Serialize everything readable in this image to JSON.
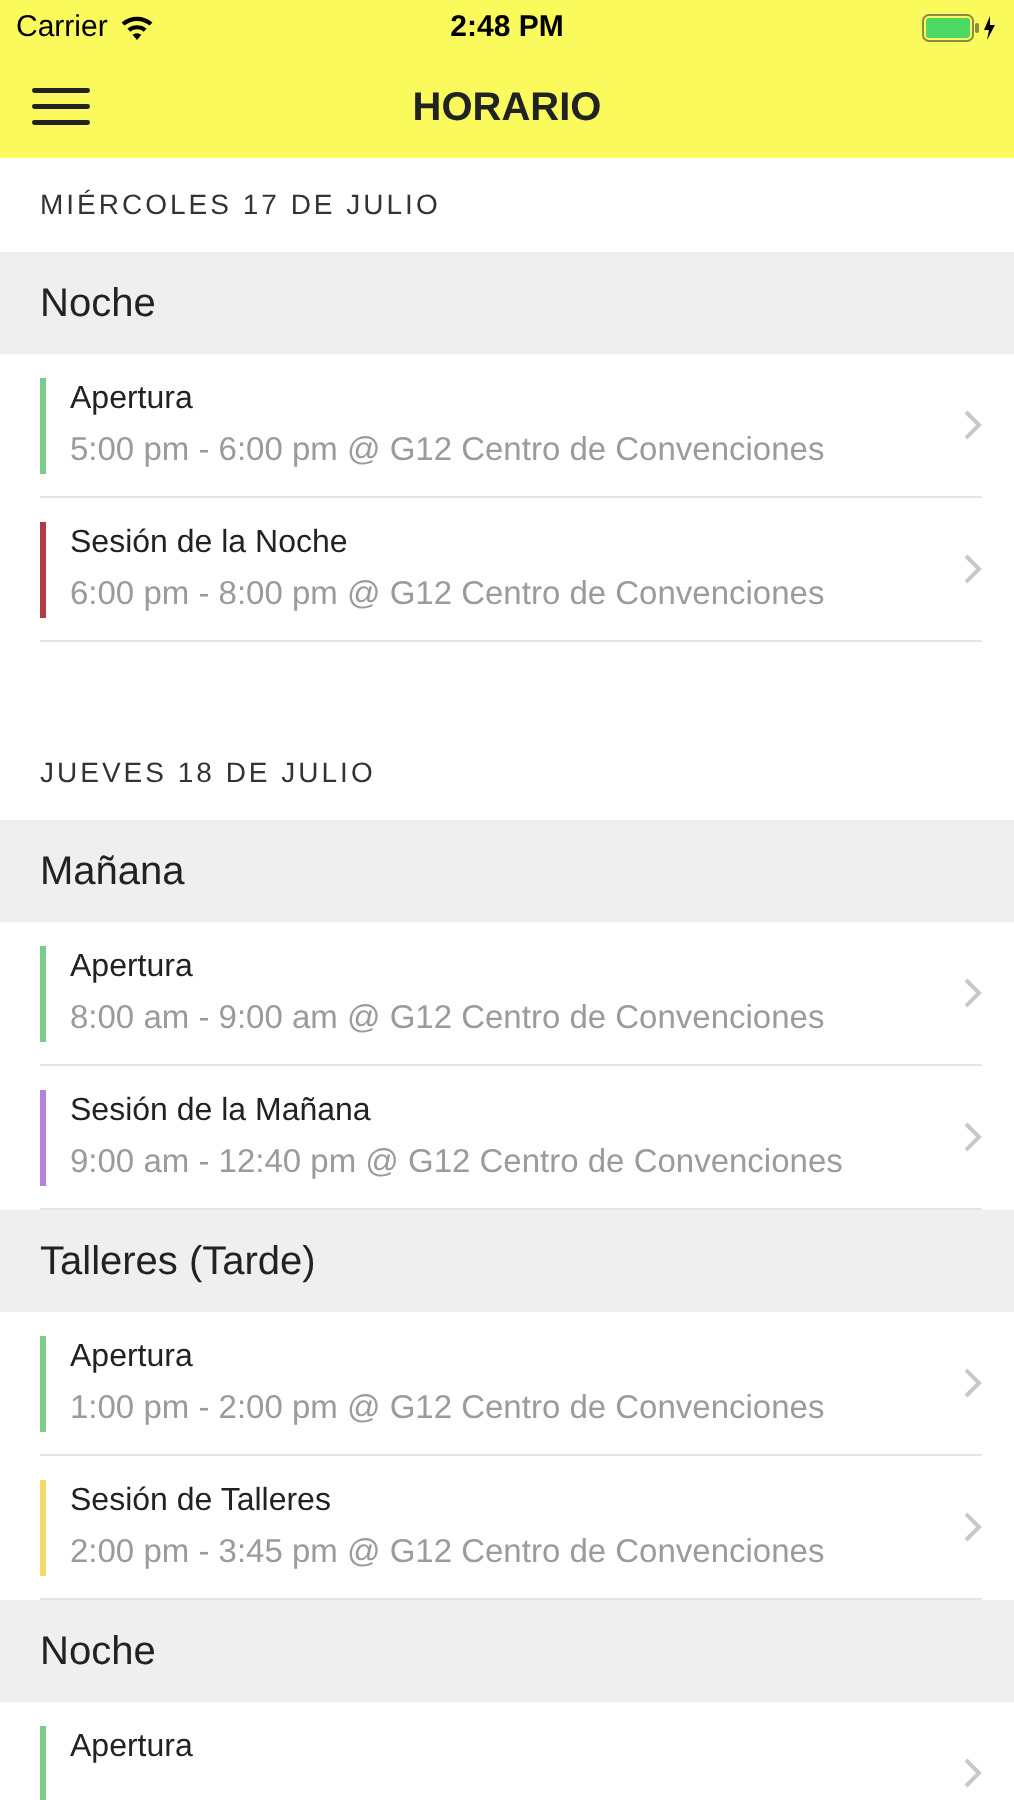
{
  "status_bar": {
    "carrier": "Carrier",
    "time": "2:48 PM"
  },
  "nav": {
    "title": "HORARIO"
  },
  "days": [
    {
      "date": "MIÉRCOLES 17 DE JULIO",
      "sections": [
        {
          "title": "Noche",
          "events": [
            {
              "title": "Apertura",
              "details": "5:00 pm - 6:00 pm @ G12 Centro de Convenciones",
              "color": "#7ccb8a"
            },
            {
              "title": "Sesión de la Noche",
              "details": "6:00 pm - 8:00 pm @ G12 Centro de Convenciones",
              "color": "#b23b3f"
            }
          ]
        }
      ]
    },
    {
      "date": "JUEVES 18 DE JULIO",
      "sections": [
        {
          "title": "Mañana",
          "events": [
            {
              "title": "Apertura",
              "details": "8:00 am - 9:00 am @ G12 Centro de Convenciones",
              "color": "#7ccb8a"
            },
            {
              "title": "Sesión de la Mañana",
              "details": "9:00 am - 12:40 pm @ G12 Centro de Convenciones",
              "color": "#b77fe0"
            }
          ]
        },
        {
          "title": "Talleres (Tarde)",
          "events": [
            {
              "title": "Apertura",
              "details": "1:00 pm - 2:00 pm @ G12 Centro de Convenciones",
              "color": "#7ccb8a"
            },
            {
              "title": "Sesión de Talleres",
              "details": "2:00 pm - 3:45 pm @ G12 Centro de Convenciones",
              "color": "#f3d96a"
            }
          ]
        },
        {
          "title": "Noche",
          "events": [
            {
              "title": "Apertura",
              "color": "#7ccb8a"
            }
          ]
        }
      ]
    }
  ]
}
